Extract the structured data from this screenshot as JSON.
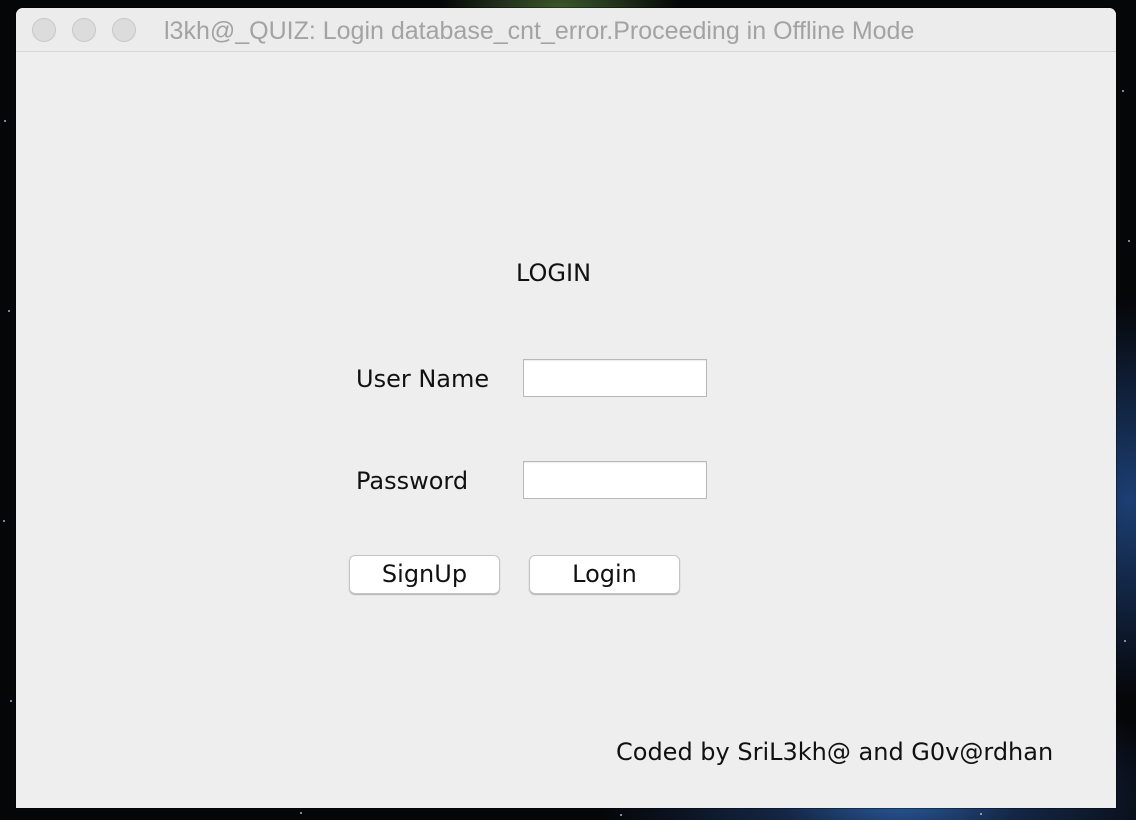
{
  "window": {
    "title": "l3kh@_QUIZ: Login database_cnt_error.Proceeding in Offline Mode"
  },
  "form": {
    "heading": "LOGIN",
    "username_label": "User Name",
    "username_value": "",
    "password_label": "Password",
    "password_value": ""
  },
  "buttons": {
    "signup_label": "SignUp",
    "login_label": "Login"
  },
  "footer": {
    "credits": "Coded by SriL3kh@ and G0v@rdhan"
  },
  "colors": {
    "window_background": "#eeeeee",
    "title_text": "#a3a3a3",
    "desktop_background": "#050608"
  }
}
